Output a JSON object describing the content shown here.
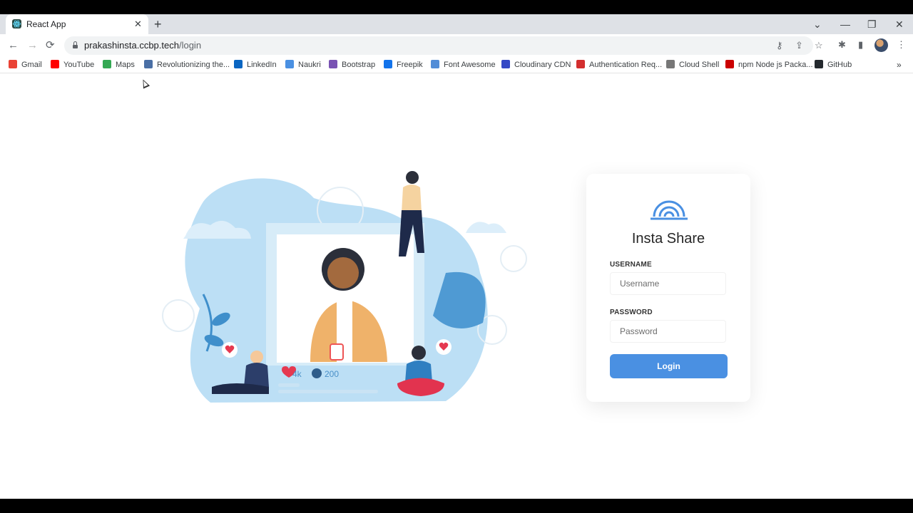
{
  "browser": {
    "tab_title": "React App",
    "tab_close": "✕",
    "new_tab": "+",
    "url_host": "prakashinsta.ccbp.tech",
    "url_path": "/login",
    "nav": {
      "back": "←",
      "forward": "→",
      "reload": "⟳"
    },
    "window": {
      "dropdown": "⌄",
      "minimize": "—",
      "restore": "❐",
      "close": "✕"
    },
    "toolbar_icons": {
      "key": "⚷",
      "share": "⇪",
      "star": "☆",
      "extensions": "✱",
      "sidepanel": "▮",
      "menu": "⋮"
    },
    "bookmarks": [
      {
        "label": "Gmail",
        "color": "#ea4335"
      },
      {
        "label": "YouTube",
        "color": "#ff0000"
      },
      {
        "label": "Maps",
        "color": "#34a853"
      },
      {
        "label": "Revolutionizing the...",
        "color": "#4a6fa5"
      },
      {
        "label": "LinkedIn",
        "color": "#0a66c2"
      },
      {
        "label": "Naukri",
        "color": "#4a90e2"
      },
      {
        "label": "Bootstrap",
        "color": "#7952b3"
      },
      {
        "label": "Freepik",
        "color": "#1273eb"
      },
      {
        "label": "Font Awesome",
        "color": "#528dd7"
      },
      {
        "label": "Cloudinary CDN",
        "color": "#3448c5"
      },
      {
        "label": "Authentication Req...",
        "color": "#d32f2f"
      },
      {
        "label": "Cloud Shell",
        "color": "#777777"
      },
      {
        "label": "npm Node js Packa...",
        "color": "#cb0000"
      },
      {
        "label": "GitHub",
        "color": "#24292e"
      }
    ],
    "bookmarks_more": "»"
  },
  "login": {
    "app_name": "Insta Share",
    "username_label": "USERNAME",
    "username_placeholder": "Username",
    "password_label": "PASSWORD",
    "password_placeholder": "Password",
    "login_button": "Login",
    "accent_color": "#4a90e2"
  },
  "illustration": {
    "likes": "4k",
    "comments": "200"
  }
}
